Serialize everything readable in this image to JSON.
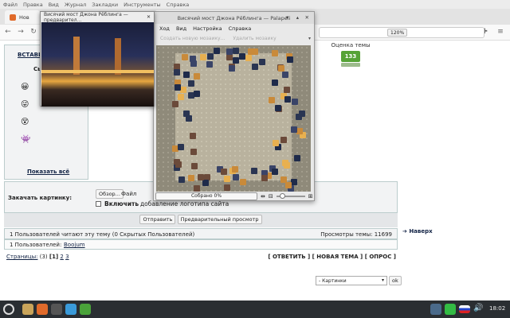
{
  "browser": {
    "menu": [
      "Файл",
      "Правка",
      "Вид",
      "Журнал",
      "Закладки",
      "Инструменты",
      "Справка"
    ],
    "tabs": [
      {
        "label": "Нов"
      },
      {
        "label": ""
      }
    ],
    "zoom": "120%"
  },
  "forum": {
    "insert_label": "ВСТАВИ",
    "smilies_label": "Сы",
    "show_all": "Показать всё",
    "upload_label": "Закачать картинку:",
    "browse_button": "Обзор...",
    "file_label": "Файл",
    "logo_checkbox_bold": "Включить",
    "logo_checkbox_rest": "добавление логотипа сайта",
    "send_button": "Отправить",
    "preview_button": "Предварительный просмотр",
    "rating_label": "Оценка темы",
    "rating_value": "133",
    "readers_text": "1 Пользователей читают эту тему (0 Скрытых Пользователей)",
    "views_text": "Просмотры темы: 11699",
    "users_prefix": "1 Пользователей:",
    "users_name": "Boojum",
    "pages_label": "Страницы:",
    "pages_count": "(3)",
    "page_current": "[1]",
    "page_2": "2",
    "page_3": "3",
    "action_reply": "[ ОТВЕТИТЬ ]",
    "action_new_topic": "[ НОВАЯ ТЕМА ]",
    "action_poll": "[ ОПРОС ]",
    "top_link": "Наверх",
    "jump_select": "- Картинки",
    "jump_ok": "ok"
  },
  "jigsaw": {
    "title": "Висячий мост Джона Рёблинга — Palapeli",
    "menu": [
      "Ход",
      "Вид",
      "Настройка",
      "Справка"
    ],
    "toolbar": [
      "Создать новую мозаику...",
      "Удалить мозаику"
    ],
    "progress_text": "Собрано 0%",
    "progress_value": 0
  },
  "preview": {
    "title": "Висячий мост Джона Рёблинга — предварител..."
  },
  "taskbar": {
    "clock": "18:02"
  }
}
